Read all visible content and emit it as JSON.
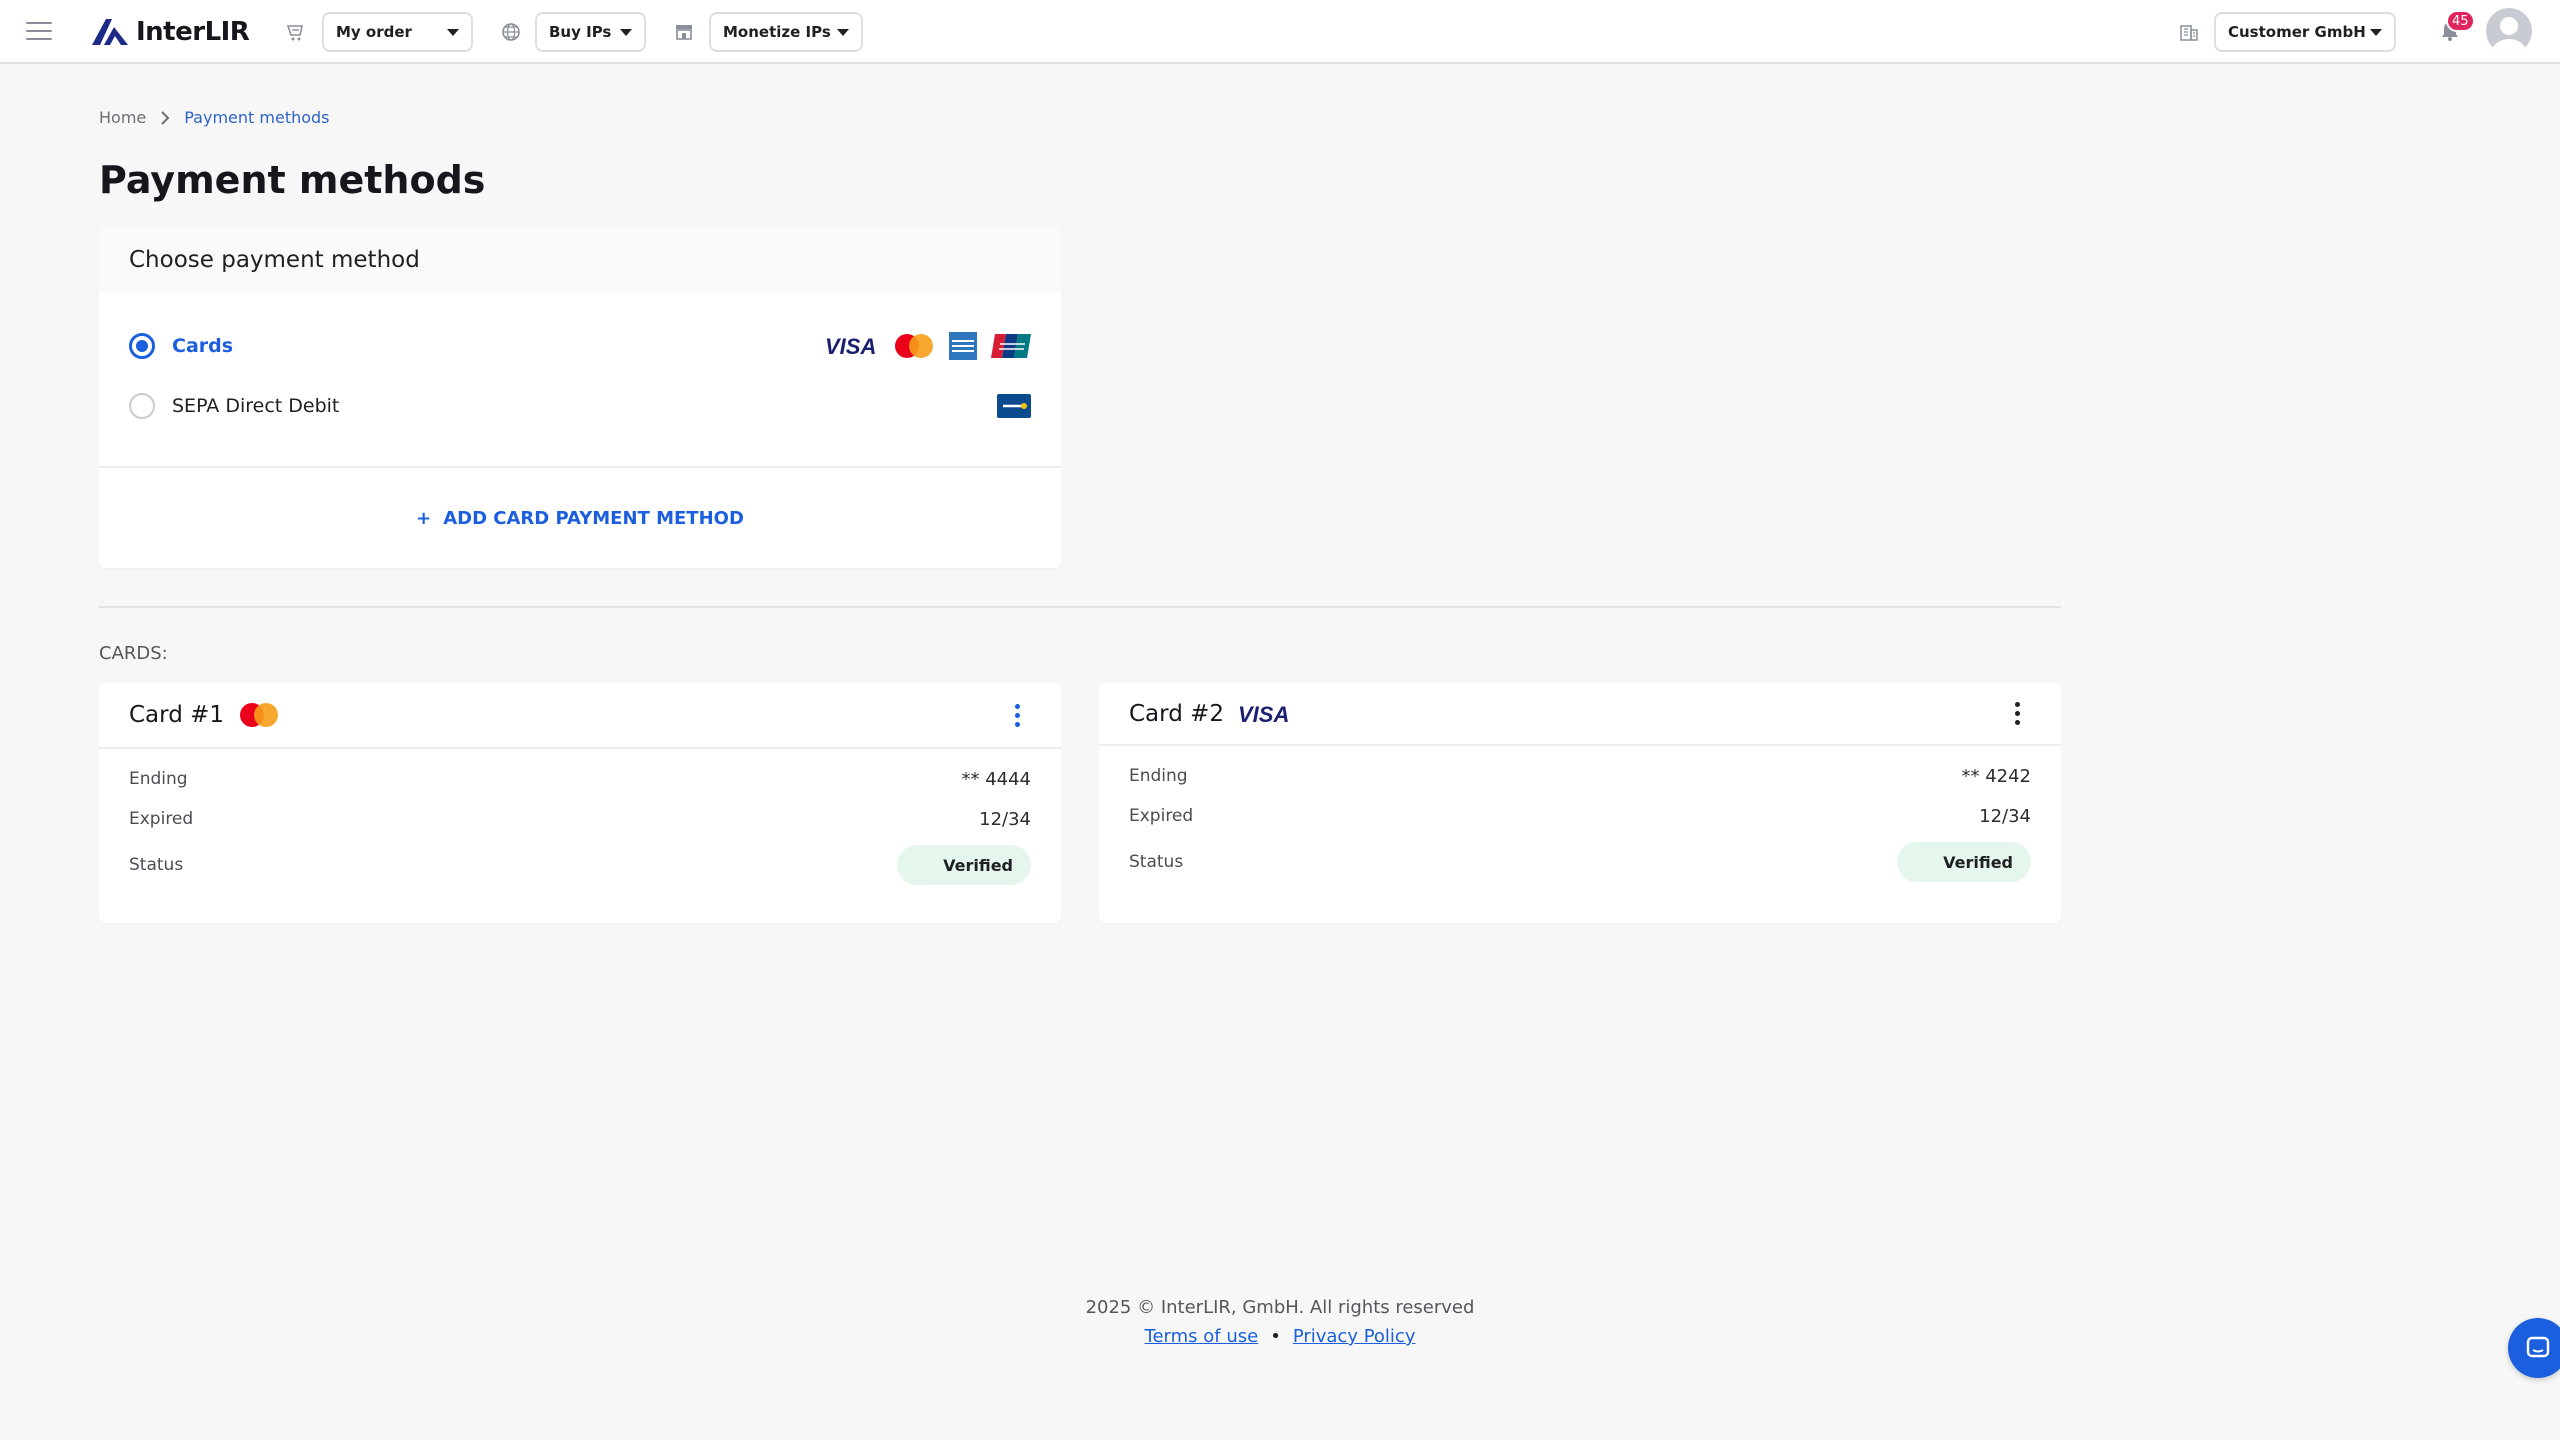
{
  "header": {
    "logo_text": "InterLIR",
    "nav": [
      {
        "label": "My order",
        "icon": "cart-icon"
      },
      {
        "label": "Buy IPs",
        "icon": "globe-icon"
      },
      {
        "label": "Monetize IPs",
        "icon": "store-icon"
      }
    ],
    "company": {
      "label": "Customer GmbH",
      "icon": "building-icon"
    },
    "notifications": {
      "count": "45",
      "icon": "bell-icon"
    }
  },
  "breadcrumb": {
    "home": "Home",
    "current": "Payment methods"
  },
  "page_title": "Payment methods",
  "payment_method_card": {
    "title": "Choose payment method",
    "options": [
      {
        "label": "Cards",
        "selected": true,
        "brands": [
          "visa",
          "mastercard",
          "amex",
          "unionpay"
        ]
      },
      {
        "label": "SEPA Direct Debit",
        "selected": false,
        "brands": [
          "sepa"
        ]
      }
    ],
    "add_button": {
      "plus": "+",
      "label": "ADD CARD PAYMENT METHOD"
    }
  },
  "cards_section": {
    "label": "CARDS:",
    "cards": [
      {
        "title": "Card #1",
        "brand": "mastercard",
        "ending_label": "Ending",
        "ending_value": "** 4444",
        "expired_label": "Expired",
        "expired_value": "12/34",
        "status_label": "Status",
        "status_value": "Verified"
      },
      {
        "title": "Card #2",
        "brand": "visa",
        "ending_label": "Ending",
        "ending_value": "** 4242",
        "expired_label": "Expired",
        "expired_value": "12/34",
        "status_label": "Status",
        "status_value": "Verified"
      }
    ]
  },
  "footer": {
    "copyright": "2025 © InterLIR, GmbH. All rights reserved",
    "terms": "Terms of use",
    "separator": "•",
    "privacy": "Privacy Policy"
  },
  "colors": {
    "accent": "#1b5fde",
    "badge": "#e0245e",
    "verified_bg": "#e5f6ec",
    "background": "#f7f7f7"
  }
}
